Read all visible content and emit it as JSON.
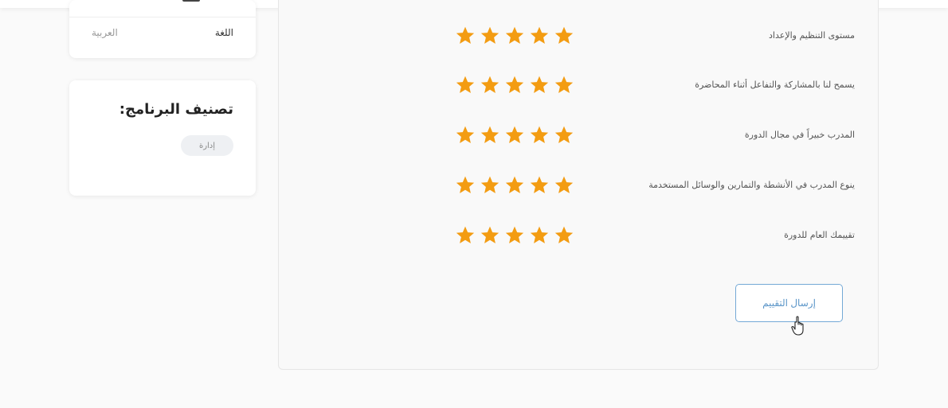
{
  "sidebar": {
    "language": {
      "label": "اللغة",
      "value": "العربية"
    },
    "category": {
      "title": "تصنيف البرنامج:",
      "tag": "إدارة"
    }
  },
  "rating": {
    "questions": [
      {
        "label": "مستوى التنظيم والإعداد",
        "stars": 5,
        "max_stars": 5
      },
      {
        "label": "يسمح لنا بالمشاركة والتفاعل أثناء المحاضرة",
        "stars": 5,
        "max_stars": 5
      },
      {
        "label": "المدرب خبيراً في مجال الدورة",
        "stars": 5,
        "max_stars": 5
      },
      {
        "label": "ينوع المدرب في الأنشطة والتمارين والوسائل المستخدمة",
        "stars": 5,
        "max_stars": 5
      },
      {
        "label": "تقييمك العام للدورة",
        "stars": 5,
        "max_stars": 5
      }
    ],
    "submit_label": "إرسال التقييم"
  },
  "colors": {
    "star": "#f39c12",
    "accent": "#5a95c8"
  },
  "icons": {
    "star": "star-icon",
    "cursor": "hand-pointer-icon"
  }
}
